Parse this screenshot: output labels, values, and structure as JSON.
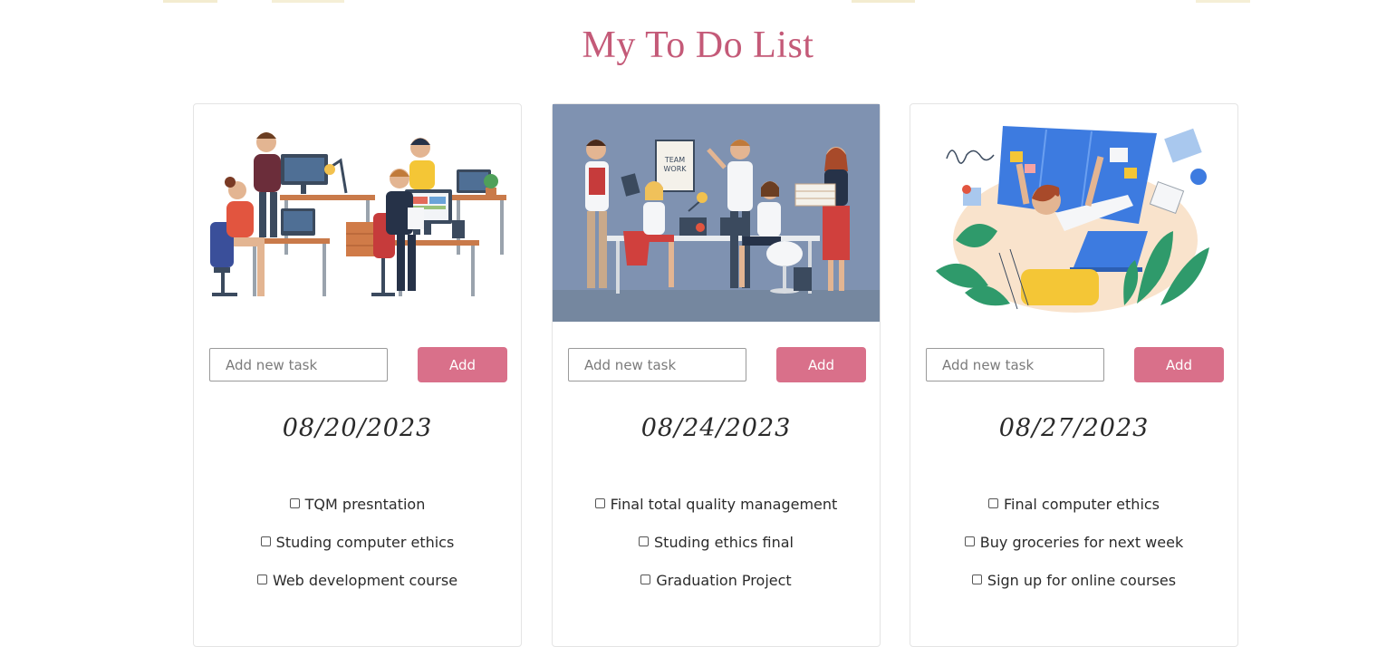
{
  "page": {
    "title": "My To Do List"
  },
  "colors": {
    "accent": "#d9708a",
    "title": "#c45a78",
    "card2_bg": "#7f92b1"
  },
  "cards": [
    {
      "illustration": "office-team-desks-illustration",
      "input_placeholder": "Add new task",
      "add_label": "Add",
      "date": "08/20/2023",
      "tasks": [
        "TQM presntation",
        "Studing computer ethics",
        "Web development course"
      ]
    },
    {
      "illustration": "teamwork-meeting-illustration",
      "input_placeholder": "Add new task",
      "add_label": "Add",
      "date": "08/24/2023",
      "poster_text": "TEAM WORK",
      "tasks": [
        "Final total quality management",
        "Studing ethics final",
        "Graduation Project"
      ]
    },
    {
      "illustration": "kanban-board-illustration",
      "input_placeholder": "Add new task",
      "add_label": "Add",
      "date": "08/27/2023",
      "tasks": [
        "Final computer ethics",
        "Buy groceries for next week",
        "Sign up for online courses"
      ]
    }
  ]
}
